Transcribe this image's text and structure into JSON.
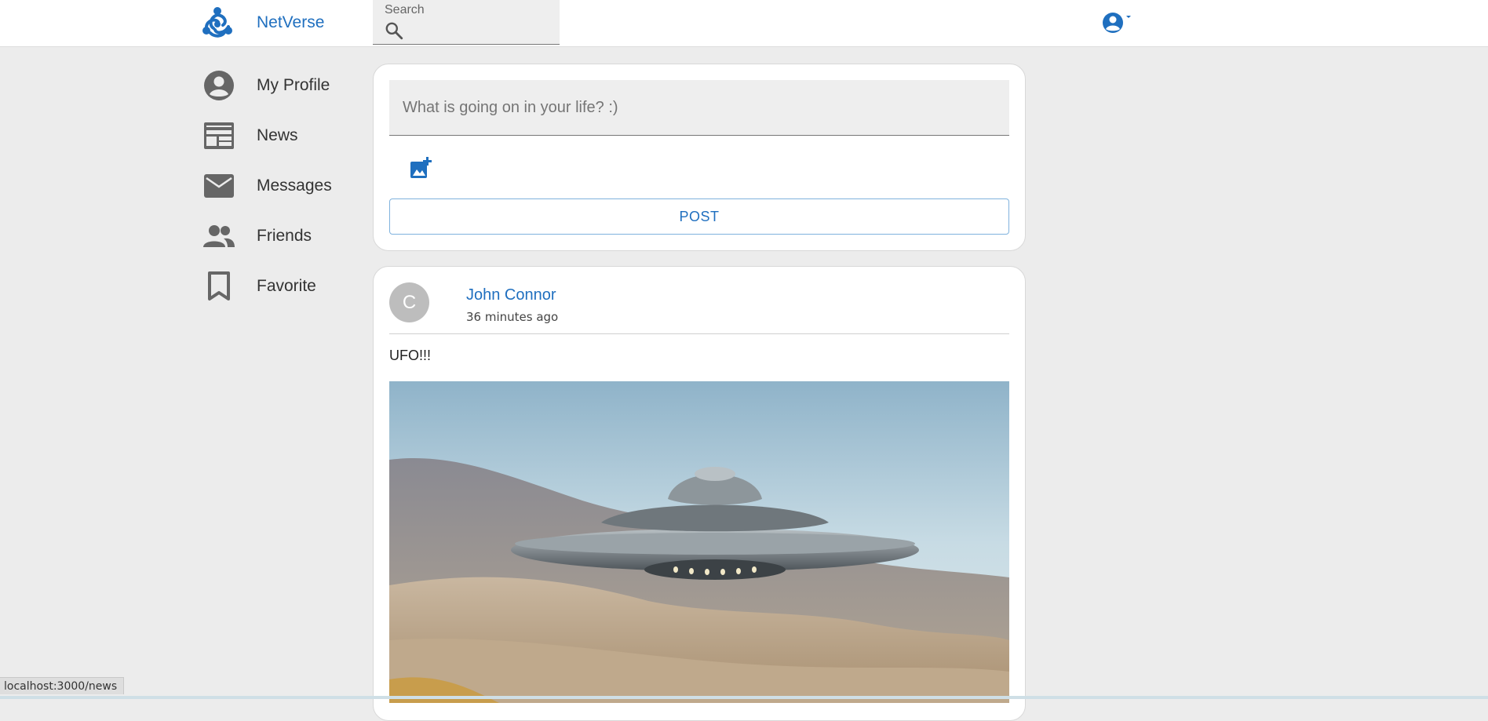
{
  "header": {
    "brand_name": "NetVerse",
    "logo_icon": "netverse-logo-icon",
    "search": {
      "label": "Search",
      "placeholder": "",
      "icon": "search-icon"
    },
    "account_icon": "account-circle-icon"
  },
  "sidebar": {
    "items": [
      {
        "label": "My Profile",
        "icon": "account-circle-icon"
      },
      {
        "label": "News",
        "icon": "newspaper-icon"
      },
      {
        "label": "Messages",
        "icon": "mail-icon"
      },
      {
        "label": "Friends",
        "icon": "people-icon"
      },
      {
        "label": "Favorite",
        "icon": "bookmark-icon"
      }
    ]
  },
  "composer": {
    "placeholder": "What is going on in your life? :)",
    "value": "",
    "add_photo_icon": "add-photo-icon",
    "post_label": "POST"
  },
  "post": {
    "avatar_letter": "C",
    "author": "John Connor",
    "time": "36 minutes ago",
    "text": "UFO!!!"
  },
  "status_bar": {
    "url": "localhost:3000/news"
  },
  "colors": {
    "accent": "#1f6fbf",
    "background": "#ececec",
    "icon_gray": "#666666"
  }
}
